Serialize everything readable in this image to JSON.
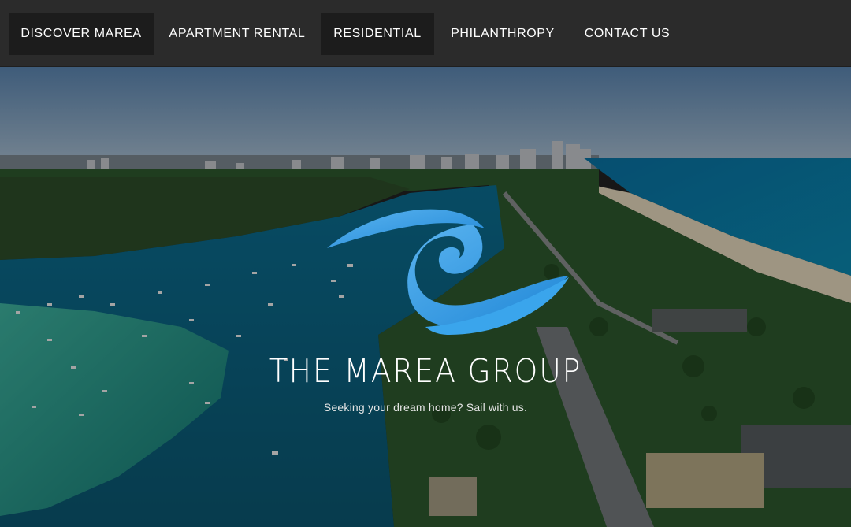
{
  "nav": {
    "items": [
      {
        "label": "DISCOVER MAREA",
        "active": true
      },
      {
        "label": "APARTMENT RENTAL",
        "active": false
      },
      {
        "label": "RESIDENTIAL",
        "active": true
      },
      {
        "label": "PHILANTHROPY",
        "active": false
      },
      {
        "label": "CONTACT US",
        "active": false
      }
    ]
  },
  "hero": {
    "title": "THE MAREA GROUP",
    "tagline": "Seeking your dream home? Sail with us.",
    "background": "aerial-coastline-photo",
    "logo_icon": "wave-icon"
  },
  "colors": {
    "nav_bg": "#2b2b2b",
    "nav_active_bg": "#1c1c1c",
    "logo_blue": "#2f9be8",
    "text": "#ffffff"
  }
}
